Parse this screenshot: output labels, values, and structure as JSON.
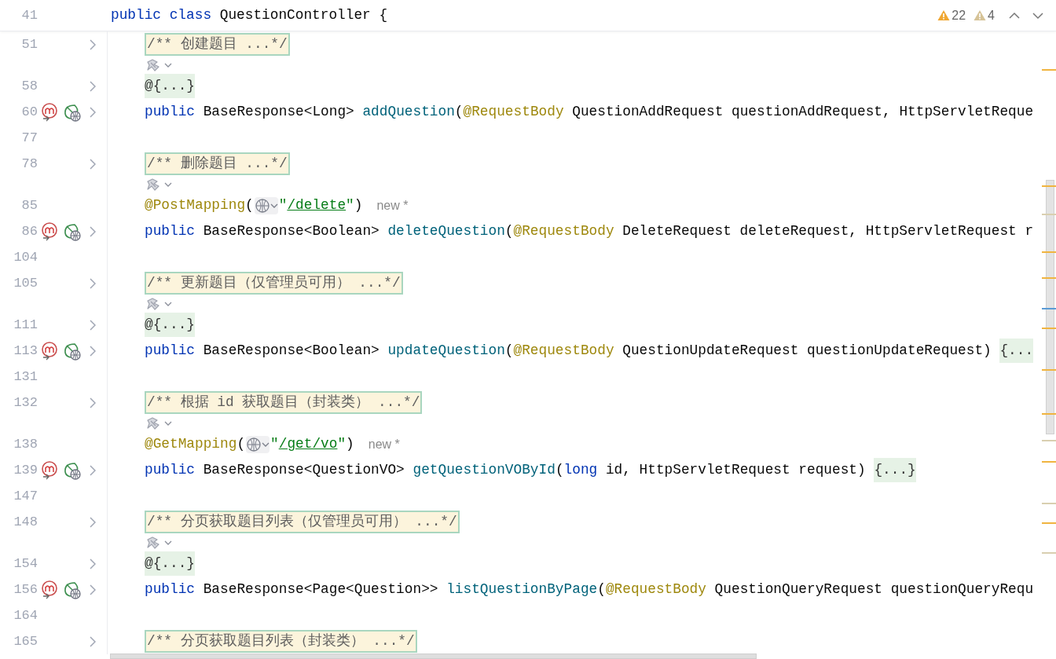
{
  "header": {
    "number": "41",
    "segments": [
      {
        "kind": "keyword",
        "text": "public class"
      },
      {
        "kind": "plain",
        "text": " QuestionController {"
      }
    ]
  },
  "problems": [
    {
      "kind": "warning",
      "count": "22"
    },
    {
      "kind": "weak_warning",
      "count": "4"
    }
  ],
  "lines": [
    {
      "kind": "code",
      "number": "51",
      "foldable": true,
      "segments": [
        {
          "kind": "comment",
          "text": "/** 创建题目 ...*/"
        }
      ]
    },
    {
      "kind": "hint"
    },
    {
      "kind": "code",
      "number": "58",
      "foldable": true,
      "segments": [
        {
          "kind": "fold",
          "text": "@{...}"
        }
      ]
    },
    {
      "kind": "code",
      "number": "60",
      "foldable": true,
      "gutter_icons": [
        {
          "kind": "mapping"
        },
        {
          "kind": "endpoint"
        }
      ],
      "segments": [
        {
          "kind": "keyword",
          "text": "public"
        },
        {
          "kind": "plain",
          "text": " BaseResponse<Long> "
        },
        {
          "kind": "method",
          "text": "addQuestion"
        },
        {
          "kind": "plain",
          "text": "("
        },
        {
          "kind": "annotation",
          "text": "@RequestBody"
        },
        {
          "kind": "plain",
          "text": " QuestionAddRequest questionAddRequest, HttpServletReque"
        }
      ]
    },
    {
      "kind": "code",
      "number": "77",
      "foldable": false
    },
    {
      "kind": "code",
      "number": "78",
      "foldable": true,
      "segments": [
        {
          "kind": "comment",
          "text": "/** 删除题目 ...*/"
        }
      ]
    },
    {
      "kind": "hint"
    },
    {
      "kind": "code",
      "number": "85",
      "foldable": false,
      "segments": [
        {
          "kind": "annotation",
          "text": "@PostMapping"
        },
        {
          "kind": "plain",
          "text": "("
        },
        {
          "kind": "endpoint_picker"
        },
        {
          "kind": "string",
          "text": "\""
        },
        {
          "kind": "url",
          "text": "/delete"
        },
        {
          "kind": "string",
          "text": "\""
        },
        {
          "kind": "plain",
          "text": ")"
        },
        {
          "kind": "hint",
          "text": "new *"
        }
      ]
    },
    {
      "kind": "code",
      "number": "86",
      "foldable": true,
      "gutter_icons": [
        {
          "kind": "mapping"
        },
        {
          "kind": "endpoint"
        }
      ],
      "segments": [
        {
          "kind": "keyword",
          "text": "public"
        },
        {
          "kind": "plain",
          "text": " BaseResponse<Boolean> "
        },
        {
          "kind": "method",
          "text": "deleteQuestion"
        },
        {
          "kind": "plain",
          "text": "("
        },
        {
          "kind": "annotation",
          "text": "@RequestBody"
        },
        {
          "kind": "plain",
          "text": " DeleteRequest deleteRequest, HttpServletRequest r"
        }
      ]
    },
    {
      "kind": "code",
      "number": "104",
      "foldable": false
    },
    {
      "kind": "code",
      "number": "105",
      "foldable": true,
      "segments": [
        {
          "kind": "comment",
          "text": "/** 更新题目（仅管理员可用） ...*/"
        }
      ]
    },
    {
      "kind": "hint"
    },
    {
      "kind": "code",
      "number": "111",
      "foldable": true,
      "segments": [
        {
          "kind": "fold",
          "text": "@{...}"
        }
      ]
    },
    {
      "kind": "code",
      "number": "113",
      "foldable": true,
      "gutter_icons": [
        {
          "kind": "mapping"
        },
        {
          "kind": "endpoint"
        }
      ],
      "segments": [
        {
          "kind": "keyword",
          "text": "public"
        },
        {
          "kind": "plain",
          "text": " BaseResponse<Boolean> "
        },
        {
          "kind": "method",
          "text": "updateQuestion"
        },
        {
          "kind": "plain",
          "text": "("
        },
        {
          "kind": "annotation",
          "text": "@RequestBody"
        },
        {
          "kind": "plain",
          "text": " QuestionUpdateRequest questionUpdateRequest) "
        },
        {
          "kind": "fold",
          "text": "{..."
        }
      ]
    },
    {
      "kind": "code",
      "number": "131",
      "foldable": false
    },
    {
      "kind": "code",
      "number": "132",
      "foldable": true,
      "segments": [
        {
          "kind": "comment",
          "text": "/** 根据 id 获取题目（封装类） ...*/"
        }
      ]
    },
    {
      "kind": "hint"
    },
    {
      "kind": "code",
      "number": "138",
      "foldable": false,
      "segments": [
        {
          "kind": "annotation",
          "text": "@GetMapping"
        },
        {
          "kind": "plain",
          "text": "("
        },
        {
          "kind": "endpoint_picker"
        },
        {
          "kind": "string",
          "text": "\""
        },
        {
          "kind": "url",
          "text": "/get/vo"
        },
        {
          "kind": "string",
          "text": "\""
        },
        {
          "kind": "plain",
          "text": ")"
        },
        {
          "kind": "hint",
          "text": "new *"
        }
      ]
    },
    {
      "kind": "code",
      "number": "139",
      "foldable": true,
      "gutter_icons": [
        {
          "kind": "mapping"
        },
        {
          "kind": "endpoint"
        }
      ],
      "segments": [
        {
          "kind": "keyword",
          "text": "public"
        },
        {
          "kind": "plain",
          "text": " BaseResponse<QuestionVO> "
        },
        {
          "kind": "method",
          "text": "getQuestionVOById"
        },
        {
          "kind": "plain",
          "text": "("
        },
        {
          "kind": "keyword",
          "text": "long"
        },
        {
          "kind": "plain",
          "text": " id, HttpServletRequest request) "
        },
        {
          "kind": "fold",
          "text": "{...}"
        }
      ]
    },
    {
      "kind": "code",
      "number": "147",
      "foldable": false
    },
    {
      "kind": "code",
      "number": "148",
      "foldable": true,
      "segments": [
        {
          "kind": "comment",
          "text": "/** 分页获取题目列表（仅管理员可用） ...*/"
        }
      ]
    },
    {
      "kind": "hint"
    },
    {
      "kind": "code",
      "number": "154",
      "foldable": true,
      "segments": [
        {
          "kind": "fold",
          "text": "@{...}"
        }
      ]
    },
    {
      "kind": "code",
      "number": "156",
      "foldable": true,
      "gutter_icons": [
        {
          "kind": "mapping"
        },
        {
          "kind": "endpoint"
        }
      ],
      "segments": [
        {
          "kind": "keyword",
          "text": "public"
        },
        {
          "kind": "plain",
          "text": " BaseResponse<Page<Question>> "
        },
        {
          "kind": "method",
          "text": "listQuestionByPage"
        },
        {
          "kind": "plain",
          "text": "("
        },
        {
          "kind": "annotation",
          "text": "@RequestBody"
        },
        {
          "kind": "plain",
          "text": " QuestionQueryRequest questionQueryRequ"
        }
      ]
    },
    {
      "kind": "code",
      "number": "164",
      "foldable": false
    },
    {
      "kind": "code",
      "number": "165",
      "foldable": true,
      "segments": [
        {
          "kind": "comment",
          "text": "/** 分页获取题目列表（封装类） ...*/"
        }
      ]
    }
  ]
}
